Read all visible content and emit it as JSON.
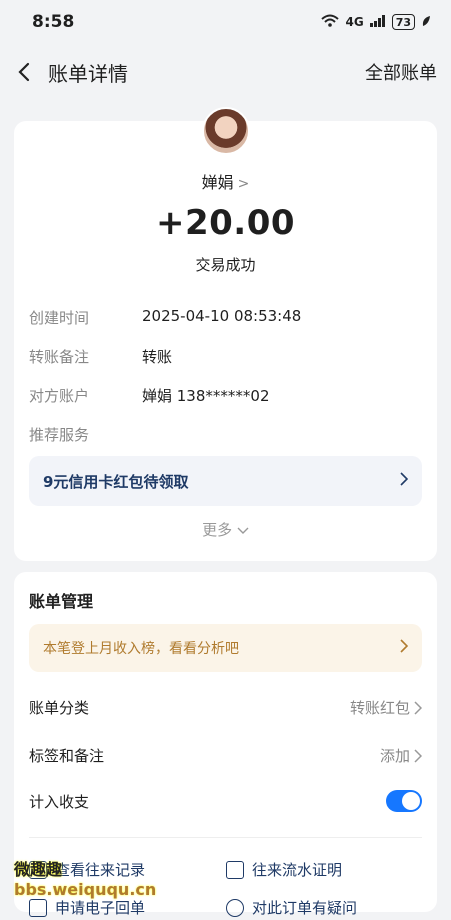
{
  "status_bar": {
    "time": "8:58",
    "network": "4G",
    "battery": "73"
  },
  "nav": {
    "title": "账单详情",
    "right_link": "全部账单"
  },
  "transaction": {
    "payer": "婵娟",
    "amount": "+20.00",
    "status": "交易成功",
    "details": [
      {
        "label": "创建时间",
        "value": "2025-04-10 08:53:48"
      },
      {
        "label": "转账备注",
        "value": "转账"
      },
      {
        "label": "对方账户",
        "value": "婵娟 138******02"
      },
      {
        "label": "推荐服务",
        "value": ""
      }
    ],
    "promo": "9元信用卡红包待领取",
    "more": "更多"
  },
  "manage": {
    "title": "账单管理",
    "banner": "本笔登上月收入榜，看看分析吧",
    "rows": [
      {
        "label": "账单分类",
        "value": "转账红包"
      },
      {
        "label": "标签和备注",
        "value": "添加"
      },
      {
        "label": "计入收支",
        "value": ""
      }
    ],
    "links": [
      {
        "label": "查看往来记录"
      },
      {
        "label": "往来流水证明"
      },
      {
        "label": "申请电子回单"
      },
      {
        "label": "对此订单有疑问"
      }
    ]
  },
  "watermark": {
    "text": "微趣趣",
    "url": "bbs.weiququ.cn"
  },
  "colors": {
    "accent": "#1677ff",
    "promo_text": "#1f3a66",
    "banner_text": "#b07b2e"
  }
}
